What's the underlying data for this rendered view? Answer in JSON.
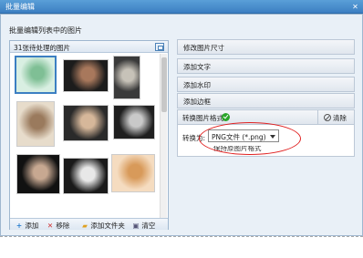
{
  "window": {
    "title": "批量编辑"
  },
  "heading": "批量编辑列表中的图片",
  "left_panel": {
    "count_label": "31张待处理的图片",
    "thumbnails": [
      {
        "name": "thumb-1",
        "colors": [
          "#d9efe2",
          "#7fbf95"
        ],
        "selected": true
      },
      {
        "name": "thumb-2",
        "colors": [
          "#1c1c1c",
          "#a8785c"
        ]
      },
      {
        "name": "thumb-3",
        "colors": [
          "#3a3a3a",
          "#c7c2b8"
        ]
      },
      {
        "name": "thumb-4",
        "colors": [
          "#e7dccb",
          "#9a7a5d"
        ]
      },
      {
        "name": "thumb-5",
        "colors": [
          "#2a2a2a",
          "#d6b79a"
        ]
      },
      {
        "name": "thumb-6",
        "colors": [
          "#1f1f1f",
          "#c9c9c9"
        ]
      },
      {
        "name": "thumb-7",
        "colors": [
          "#111111",
          "#c7a891"
        ]
      },
      {
        "name": "thumb-8",
        "colors": [
          "#1a1a1a",
          "#e8e8e8"
        ]
      },
      {
        "name": "thumb-9",
        "colors": [
          "#f5dcc0",
          "#d89a5a"
        ]
      }
    ],
    "toolbar": {
      "add": "添加",
      "remove": "移除",
      "add_folder": "添加文件夹",
      "clear": "清空"
    }
  },
  "right_panel": {
    "items": [
      "修改图片尺寸",
      "添加文字",
      "添加水印",
      "添加边框"
    ],
    "format": {
      "title": "转换图片格式",
      "clear": "清除",
      "convert_label": "转换为:",
      "selected_format": "PNG文件 (*.png)",
      "dropdown_peek": "保持原图片格式"
    }
  }
}
